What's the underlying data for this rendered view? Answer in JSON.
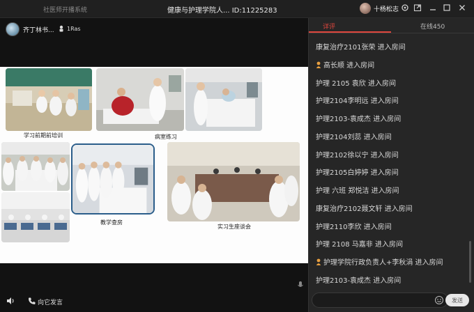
{
  "titlebar": {
    "left_title": "社医师开播系统",
    "center_title": "健康与护理学院人... ID:11225283",
    "username": "十杨松志"
  },
  "host": {
    "name": "齐丁林书...",
    "viewers": "1Ras"
  },
  "slide": {
    "captions": {
      "c1": "学习前期前培训",
      "c2": "病室练习",
      "c3": "教学查房",
      "c4": "实习生座谈会"
    }
  },
  "bottom": {
    "call_label": "向它发言"
  },
  "panel": {
    "tab_chat": "详评",
    "tab_online": "在线450",
    "messages": [
      {
        "text": "康复治疗2101张荣 进入房间",
        "guard": false
      },
      {
        "text": "高长顺 进入房间",
        "guard": true
      },
      {
        "text": "护理 2105 袁欣 进入房间",
        "guard": false
      },
      {
        "text": "护理2104李明远 进入房间",
        "guard": false
      },
      {
        "text": "护理2103-袁成杰 进入房间",
        "guard": false
      },
      {
        "text": "护理2104刘蕊 进入房间",
        "guard": false
      },
      {
        "text": "护理2102徐以宁 进入房间",
        "guard": false
      },
      {
        "text": "护理2105白婷婷 进入房间",
        "guard": false
      },
      {
        "text": "护理 六班 郑悦洁 进入房间",
        "guard": false
      },
      {
        "text": "康复治疗2102聂文轩 进入房间",
        "guard": false
      },
      {
        "text": "护理2110李欣 进入房间",
        "guard": false
      },
      {
        "text": "护理 2108 马嘉非 进入房间",
        "guard": false
      },
      {
        "text": "护理学院行政负责人+李秋涓 进入房间",
        "guard": true
      },
      {
        "text": "护理2103-袁成杰 进入房间",
        "guard": false
      }
    ],
    "send_label": "发送",
    "input_placeholder": ""
  }
}
